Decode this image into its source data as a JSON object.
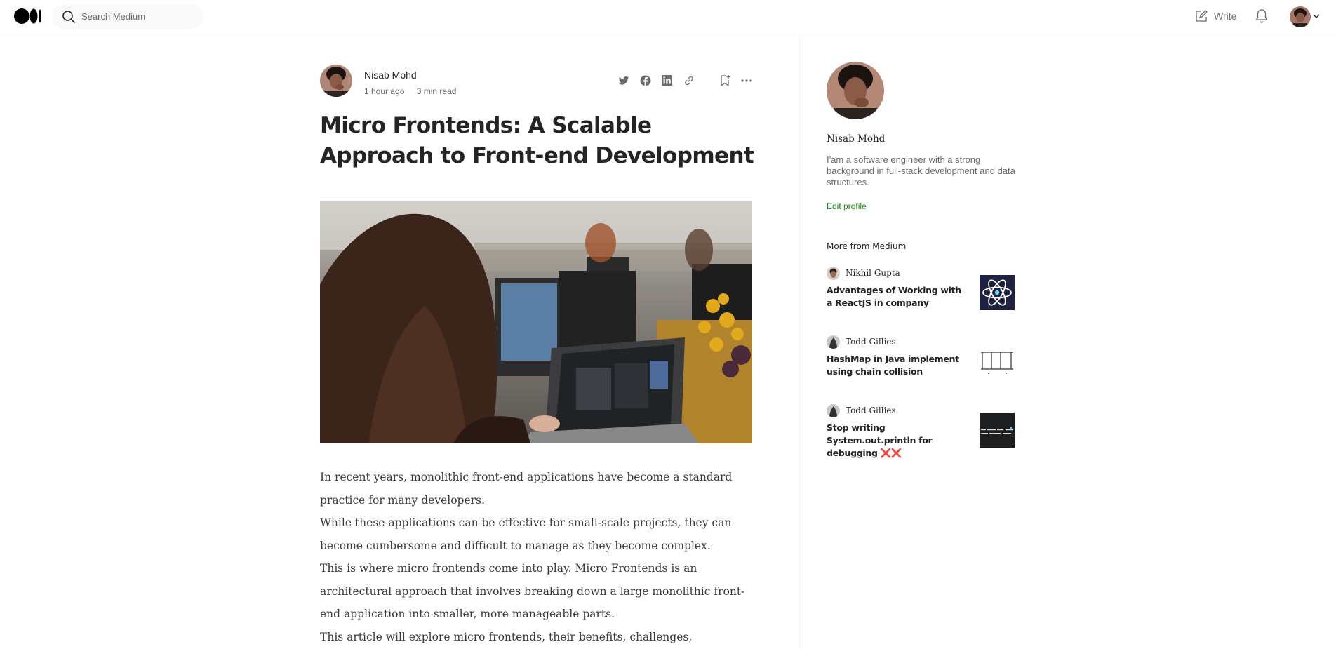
{
  "topbar": {
    "search_placeholder": "Search Medium",
    "write_label": "Write"
  },
  "article": {
    "author": "Nisab Mohd",
    "time_ago": "1 hour ago",
    "read_time": "3 min read",
    "title": "Micro Frontends: A Scalable Approach to Front-end Development",
    "paragraphs": [
      "In recent years, monolithic front-end applications have become a standard practice for many developers.",
      "While these applications can be effective for small-scale projects, they can become cumbersome and difficult to manage as they become complex.",
      "This is where micro frontends come into play. Micro Frontends is an architectural approach that involves breaking down a large monolithic front-end application into smaller, more manageable parts.",
      "This article will explore micro frontends, their benefits, challenges,"
    ]
  },
  "sidebar": {
    "name": "Nisab Mohd",
    "bio": "I'am a software engineer with a strong background in full-stack development and data structures.",
    "edit_profile": "Edit profile",
    "more_heading": "More from Medium",
    "recommendations": [
      {
        "author": "Nikhil Gupta",
        "title": "Advantages of Working with a ReactJS in company"
      },
      {
        "author": "Todd Gillies",
        "title": "HashMap in Java implement using chain collision"
      },
      {
        "author": "Todd Gillies",
        "title": "Stop writing System.out.println for debugging ❌❌"
      }
    ]
  },
  "colors": {
    "accent_green": "#1a8917",
    "text_primary": "#242424",
    "text_secondary": "#6b6b6b"
  }
}
